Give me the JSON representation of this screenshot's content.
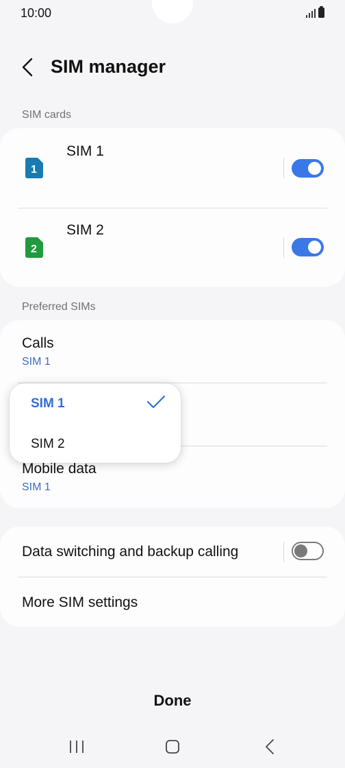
{
  "status_bar": {
    "time": "10:00"
  },
  "header": {
    "title": "SIM manager"
  },
  "sections": {
    "sim_cards": "SIM cards",
    "preferred_sims": "Preferred SIMs"
  },
  "sim_cards": [
    {
      "name": "SIM 1",
      "badge": "1",
      "color": "#1a7bb0",
      "enabled": true
    },
    {
      "name": "SIM 2",
      "badge": "2",
      "color": "#1f9a3c",
      "enabled": true
    }
  ],
  "preferred": {
    "calls": {
      "title": "Calls",
      "value": "SIM 1"
    },
    "mobile_data": {
      "title": "Mobile data",
      "value": "SIM 1"
    }
  },
  "dropdown": {
    "options": [
      "SIM 1",
      "SIM 2"
    ],
    "selected": "SIM 1"
  },
  "extras": {
    "data_switching": {
      "label": "Data switching and backup calling",
      "enabled": false
    },
    "more_settings": "More SIM settings"
  },
  "done_label": "Done",
  "colors": {
    "accent": "#3a78e8",
    "link": "#3a6bc4"
  }
}
